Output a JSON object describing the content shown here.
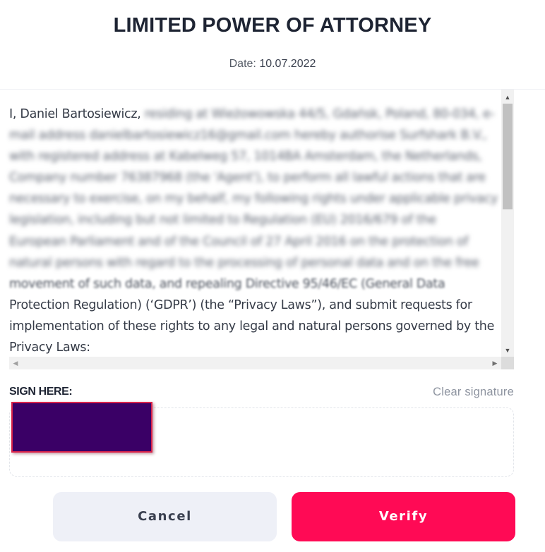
{
  "header": {
    "title": "LIMITED POWER OF ATTORNEY",
    "date_label": "Date:",
    "date_value": "10.07.2022"
  },
  "document": {
    "intro": "I, ",
    "name": "Daniel Bartosiewicz,",
    "blurred_lines": [
      "residing at Wieżowowska 44/5, Gdańsk, Poland, 80-034, e-",
      "mail address danielbartosiewicz16@gmail.com hereby authorise Surfshark B.V.,",
      "with registered address at Kabelweg 57, 1014BA Amsterdam, the Netherlands,",
      "Company number 76387968 (the 'Agent'), to perform all lawful actions that are",
      "necessary to exercise, on my behalf, my following rights under applicable privacy",
      "legislation, including but not limited to Regulation (EU) 2016/679 of the",
      "European Parliament and of the Council of 27 April 2016 on the protection of",
      "natural persons with regard to the processing of personal data and on the free",
      "movement of such data, and repealing Directive 95/46/EC (General Data"
    ],
    "visible_lines": [
      "Protection Regulation) (‘GDPR’) (the “Privacy Laws”), and submit requests for",
      "implementation of these rights to any legal and natural persons governed by the",
      "Privacy Laws:"
    ]
  },
  "signature": {
    "label": "SIGN HERE:",
    "clear_label": "Clear signature"
  },
  "actions": {
    "cancel_label": "Cancel",
    "verify_label": "Verify"
  },
  "colors": {
    "accent": "#ff0a55",
    "cancel_bg": "#eef0f7",
    "title": "#1e2433",
    "redaction": "#3a0066"
  }
}
